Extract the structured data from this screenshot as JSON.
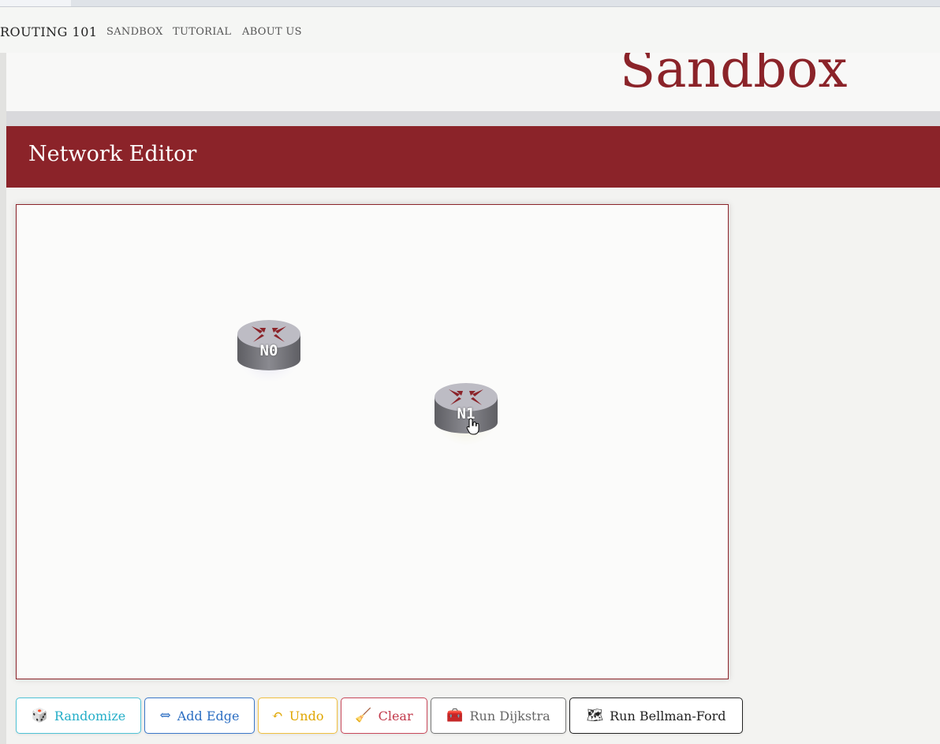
{
  "nav": {
    "brand": "ROUTING 101",
    "links": [
      "SANDBOX",
      "TUTORIAL",
      "ABOUT US"
    ]
  },
  "hero": {
    "title": "Sandbox"
  },
  "editor": {
    "title": "Network Editor"
  },
  "nodes": [
    {
      "label": "N0"
    },
    {
      "label": "N1"
    }
  ],
  "buttons": {
    "randomize": {
      "icon": "🎲",
      "label": "Randomize"
    },
    "add_edge": {
      "icon": "⇔",
      "label": "Add Edge"
    },
    "undo": {
      "icon": "↶",
      "label": "Undo"
    },
    "clear": {
      "icon": "🧹",
      "label": "Clear"
    },
    "dijkstra": {
      "icon": "🧰",
      "label": "Run Dijkstra"
    },
    "bellman": {
      "icon": "🗺",
      "label": "Run Bellman-Ford"
    }
  },
  "colors": {
    "brand": "#8b2329",
    "router_top": "#b9b8c0",
    "router_side": "#6b6b70",
    "router_arrows": "#8b2329"
  }
}
